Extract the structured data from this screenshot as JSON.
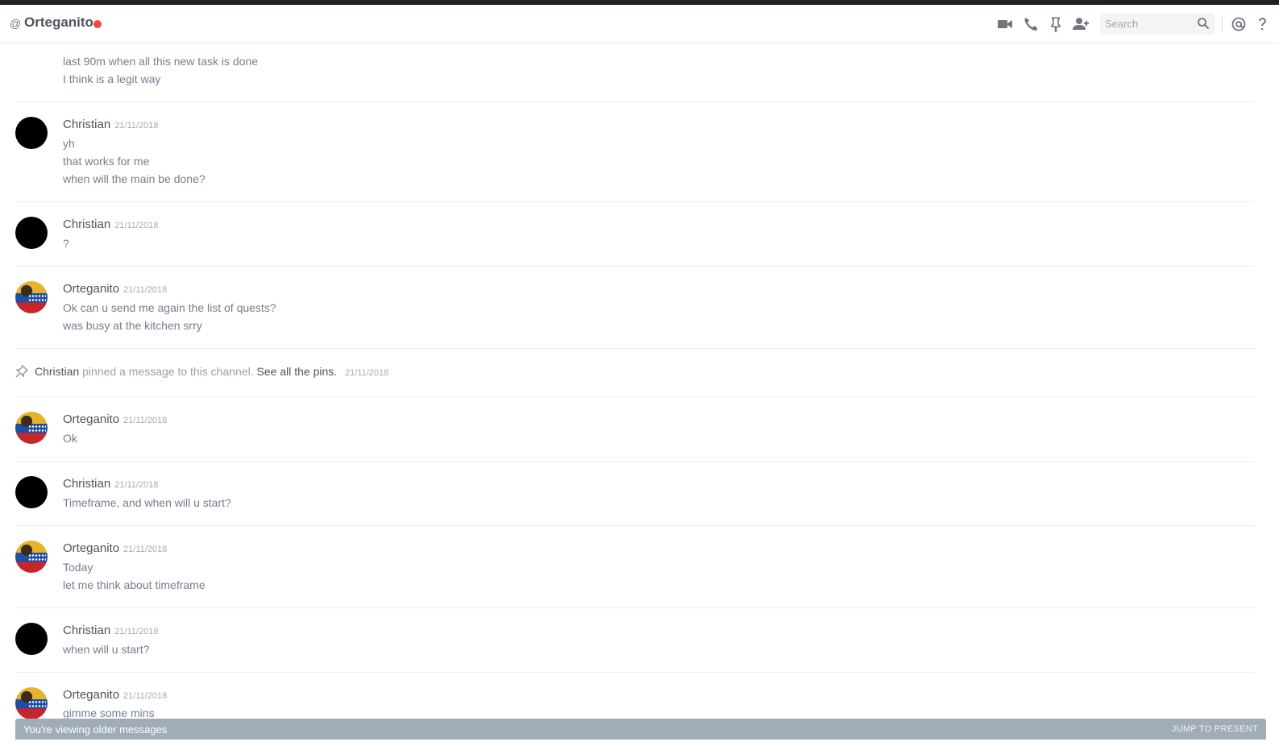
{
  "header": {
    "at_symbol": "@",
    "channel_name": "Orteganito",
    "status_color": "#f04747",
    "icons": [
      "video-call-icon",
      "phone-call-icon",
      "pin-icon",
      "add-friend-icon",
      "mention-icon",
      "help-icon"
    ],
    "search_placeholder": "Search"
  },
  "messages": [
    {
      "lines": [
        "last 90m when all this new task is done",
        "I think is a legit way"
      ]
    },
    {
      "author": "Christian",
      "timestamp": "21/11/2018",
      "avatar": "black",
      "lines": [
        "yh",
        "that works for me",
        "when will the main be done?"
      ]
    },
    {
      "author": "Christian",
      "timestamp": "21/11/2018",
      "avatar": "black",
      "lines": [
        "?"
      ]
    },
    {
      "author": "Orteganito",
      "timestamp": "21/11/2018",
      "avatar": "flag",
      "lines": [
        "Ok can u send me again the list of quests?",
        "was busy at the kitchen srry"
      ]
    },
    {
      "author": "Orteganito",
      "timestamp": "21/11/2018",
      "avatar": "flag",
      "lines": [
        "Ok"
      ]
    },
    {
      "author": "Christian",
      "timestamp": "21/11/2018",
      "avatar": "black",
      "lines": [
        "Timeframe, and when will u start?"
      ]
    },
    {
      "author": "Orteganito",
      "timestamp": "21/11/2018",
      "avatar": "flag",
      "lines": [
        "Today",
        "let me think about timeframe"
      ]
    },
    {
      "author": "Christian",
      "timestamp": "21/11/2018",
      "avatar": "black",
      "lines": [
        "when will u start?"
      ]
    },
    {
      "author": "Orteganito",
      "timestamp": "21/11/2018",
      "avatar": "flag",
      "lines": [
        "gimme some mins"
      ]
    }
  ],
  "pin_notice": {
    "author": "Christian",
    "action": "pinned a message to this channel.",
    "link": "See all the pins.",
    "timestamp": "21/11/2018"
  },
  "older_bar": {
    "text": "You're viewing older messages",
    "jump_label": "JUMP TO PRESENT"
  }
}
